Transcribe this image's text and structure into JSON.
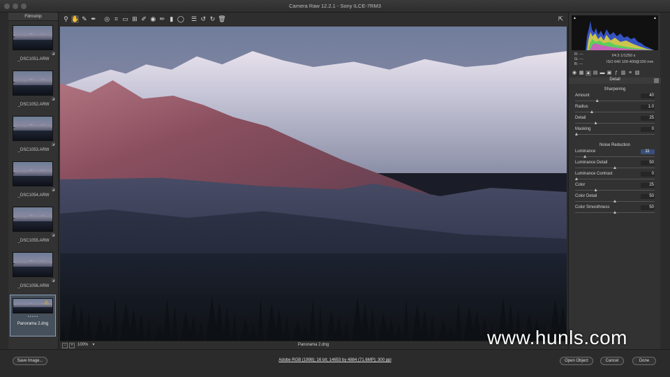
{
  "window": {
    "title": "Camera Raw 12.2.1  -  Sony ILCE-7RM3"
  },
  "toolbar": {
    "tools": [
      {
        "icon": "zoom-icon",
        "glyph": "⚲"
      },
      {
        "icon": "hand-icon",
        "glyph": "✋"
      },
      {
        "icon": "white-balance-icon",
        "glyph": "✎"
      },
      {
        "icon": "color-sampler-icon",
        "glyph": "✒"
      },
      {
        "icon": "targeted-adjustment-icon",
        "glyph": "◎"
      },
      {
        "icon": "crop-icon",
        "glyph": "⌗"
      },
      {
        "icon": "straighten-icon",
        "glyph": "▭"
      },
      {
        "icon": "transform-icon",
        "glyph": "⊞"
      },
      {
        "icon": "spot-removal-icon",
        "glyph": "✐"
      },
      {
        "icon": "red-eye-icon",
        "glyph": "◉"
      },
      {
        "icon": "adjustment-brush-icon",
        "glyph": "✏"
      },
      {
        "icon": "graduated-filter-icon",
        "glyph": "▮"
      },
      {
        "icon": "radial-filter-icon",
        "glyph": "◯"
      },
      {
        "icon": "preferences-icon",
        "glyph": "☰"
      },
      {
        "icon": "rotate-left-icon",
        "glyph": "↺"
      },
      {
        "icon": "rotate-right-icon",
        "glyph": "↻"
      },
      {
        "icon": "trash-icon",
        "glyph": "🗑"
      }
    ],
    "fullscreen_icon": "⇱"
  },
  "filmstrip": {
    "title": "Filmstrip",
    "items": [
      {
        "name": "_DSC1051.ARW"
      },
      {
        "name": "_DSC1052.ARW"
      },
      {
        "name": "_DSC1053.ARW"
      },
      {
        "name": "_DSC1054.ARW"
      },
      {
        "name": "_DSC1055.ARW"
      },
      {
        "name": "_DSC1056.ARW"
      }
    ],
    "selected": {
      "name": "Panorama 2.dng",
      "rating": "• • • • •",
      "warning_icon": "⚠"
    }
  },
  "viewer": {
    "zoom": "100%",
    "filename": "Panorama 2.dng"
  },
  "histogram": {
    "info_left": [
      "R:  ---",
      "G:  ---",
      "B:  ---"
    ],
    "info_right_1": "f/4.5     1/1250 s",
    "info_right_2": "ISO 640    100-400@100 mm"
  },
  "panel": {
    "title": "Detail",
    "sharpening_title": "Sharpening",
    "sharpening": [
      {
        "label": "Amount",
        "value": "40",
        "pos": 0.27
      },
      {
        "label": "Radius",
        "value": "1.0",
        "pos": 0.2
      },
      {
        "label": "Detail",
        "value": "25",
        "pos": 0.25
      },
      {
        "label": "Masking",
        "value": "0",
        "pos": 0.0
      }
    ],
    "noise_title": "Noise Reduction",
    "noise": [
      {
        "label": "Luminance",
        "value": "11",
        "pos": 0.11,
        "focus": true
      },
      {
        "label": "Luminance Detail",
        "value": "50",
        "pos": 0.5
      },
      {
        "label": "Luminance Contrast",
        "value": "0",
        "pos": 0.0
      },
      {
        "label": "Color",
        "value": "25",
        "pos": 0.25
      },
      {
        "label": "Color Detail",
        "value": "50",
        "pos": 0.5
      },
      {
        "label": "Color Smoothness",
        "value": "50",
        "pos": 0.5
      }
    ]
  },
  "bottom": {
    "save": "Save Image...",
    "workflow": "Adobe RGB (1998); 16 bit; 14653 by 4884 (71.6MP); 300 ppi",
    "open": "Open Object",
    "cancel": "Cancel",
    "done": "Done"
  },
  "watermark": "www.hunls.com"
}
